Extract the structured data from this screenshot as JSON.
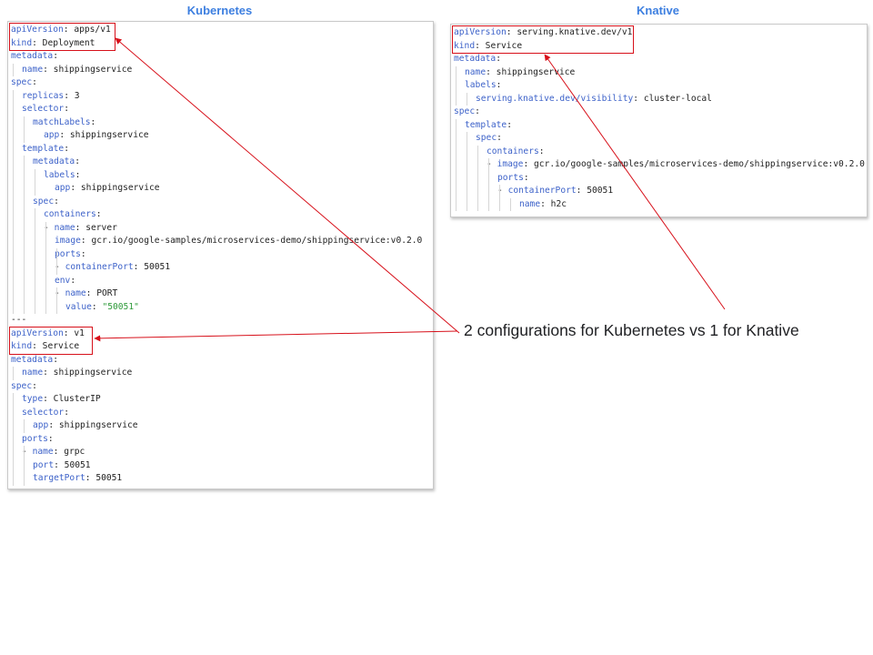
{
  "colors": {
    "title": "#3d7fe0",
    "key": "#3d62c9",
    "string": "#2e9a3a",
    "highlight": "#d7101a"
  },
  "kubernetes": {
    "title": "Kubernetes",
    "lines": [
      {
        "indent": 0,
        "dash": false,
        "key": "apiVersion",
        "value": "apps/v1"
      },
      {
        "indent": 0,
        "dash": false,
        "key": "kind",
        "value": "Deployment"
      },
      {
        "indent": 0,
        "dash": false,
        "key": "metadata",
        "value": ""
      },
      {
        "indent": 1,
        "dash": false,
        "key": "name",
        "value": "shippingservice"
      },
      {
        "indent": 0,
        "dash": false,
        "key": "spec",
        "value": ""
      },
      {
        "indent": 1,
        "dash": false,
        "key": "replicas",
        "value": "3"
      },
      {
        "indent": 1,
        "dash": false,
        "key": "selector",
        "value": ""
      },
      {
        "indent": 2,
        "dash": false,
        "key": "matchLabels",
        "value": ""
      },
      {
        "indent": 3,
        "dash": false,
        "key": "app",
        "value": "shippingservice"
      },
      {
        "indent": 1,
        "dash": false,
        "key": "template",
        "value": ""
      },
      {
        "indent": 2,
        "dash": false,
        "key": "metadata",
        "value": ""
      },
      {
        "indent": 3,
        "dash": false,
        "key": "labels",
        "value": ""
      },
      {
        "indent": 4,
        "dash": false,
        "key": "app",
        "value": "shippingservice"
      },
      {
        "indent": 2,
        "dash": false,
        "key": "spec",
        "value": ""
      },
      {
        "indent": 3,
        "dash": false,
        "key": "containers",
        "value": ""
      },
      {
        "indent": 3,
        "dash": true,
        "key": "name",
        "value": "server"
      },
      {
        "indent": 4,
        "dash": false,
        "key": "image",
        "value": "gcr.io/google-samples/microservices-demo/shippingservice:v0.2.0"
      },
      {
        "indent": 4,
        "dash": false,
        "key": "ports",
        "value": ""
      },
      {
        "indent": 4,
        "dash": true,
        "key": "containerPort",
        "value": "50051"
      },
      {
        "indent": 4,
        "dash": false,
        "key": "env",
        "value": ""
      },
      {
        "indent": 4,
        "dash": true,
        "key": "name",
        "value": "PORT"
      },
      {
        "indent": 5,
        "dash": false,
        "key": "value",
        "value": "\"50051\"",
        "string": true
      },
      {
        "indent": 0,
        "dash": false,
        "key": "",
        "value": "",
        "raw": "---"
      },
      {
        "indent": 0,
        "dash": false,
        "key": "apiVersion",
        "value": "v1"
      },
      {
        "indent": 0,
        "dash": false,
        "key": "kind",
        "value": "Service"
      },
      {
        "indent": 0,
        "dash": false,
        "key": "metadata",
        "value": ""
      },
      {
        "indent": 1,
        "dash": false,
        "key": "name",
        "value": "shippingservice"
      },
      {
        "indent": 0,
        "dash": false,
        "key": "spec",
        "value": ""
      },
      {
        "indent": 1,
        "dash": false,
        "key": "type",
        "value": "ClusterIP"
      },
      {
        "indent": 1,
        "dash": false,
        "key": "selector",
        "value": ""
      },
      {
        "indent": 2,
        "dash": false,
        "key": "app",
        "value": "shippingservice"
      },
      {
        "indent": 1,
        "dash": false,
        "key": "ports",
        "value": ""
      },
      {
        "indent": 1,
        "dash": true,
        "key": "name",
        "value": "grpc"
      },
      {
        "indent": 2,
        "dash": false,
        "key": "port",
        "value": "50051"
      },
      {
        "indent": 2,
        "dash": false,
        "key": "targetPort",
        "value": "50051"
      }
    ]
  },
  "knative": {
    "title": "Knative",
    "lines": [
      {
        "indent": 0,
        "dash": false,
        "key": "apiVersion",
        "value": "serving.knative.dev/v1"
      },
      {
        "indent": 0,
        "dash": false,
        "key": "kind",
        "value": "Service"
      },
      {
        "indent": 0,
        "dash": false,
        "key": "metadata",
        "value": ""
      },
      {
        "indent": 1,
        "dash": false,
        "key": "name",
        "value": "shippingservice"
      },
      {
        "indent": 1,
        "dash": false,
        "key": "labels",
        "value": ""
      },
      {
        "indent": 2,
        "dash": false,
        "key": "serving.knative.dev/visibility",
        "value": "cluster-local"
      },
      {
        "indent": 0,
        "dash": false,
        "key": "spec",
        "value": ""
      },
      {
        "indent": 1,
        "dash": false,
        "key": "template",
        "value": ""
      },
      {
        "indent": 2,
        "dash": false,
        "key": "spec",
        "value": ""
      },
      {
        "indent": 3,
        "dash": false,
        "key": "containers",
        "value": ""
      },
      {
        "indent": 3,
        "dash": true,
        "key": "image",
        "value": "gcr.io/google-samples/microservices-demo/shippingservice:v0.2.0"
      },
      {
        "indent": 4,
        "dash": false,
        "key": "ports",
        "value": ""
      },
      {
        "indent": 4,
        "dash": true,
        "key": "containerPort",
        "value": "50051"
      },
      {
        "indent": 6,
        "dash": false,
        "key": "name",
        "value": "h2c"
      }
    ]
  },
  "callout": {
    "text": "2 configurations for Kubernetes vs 1 for Knative"
  }
}
